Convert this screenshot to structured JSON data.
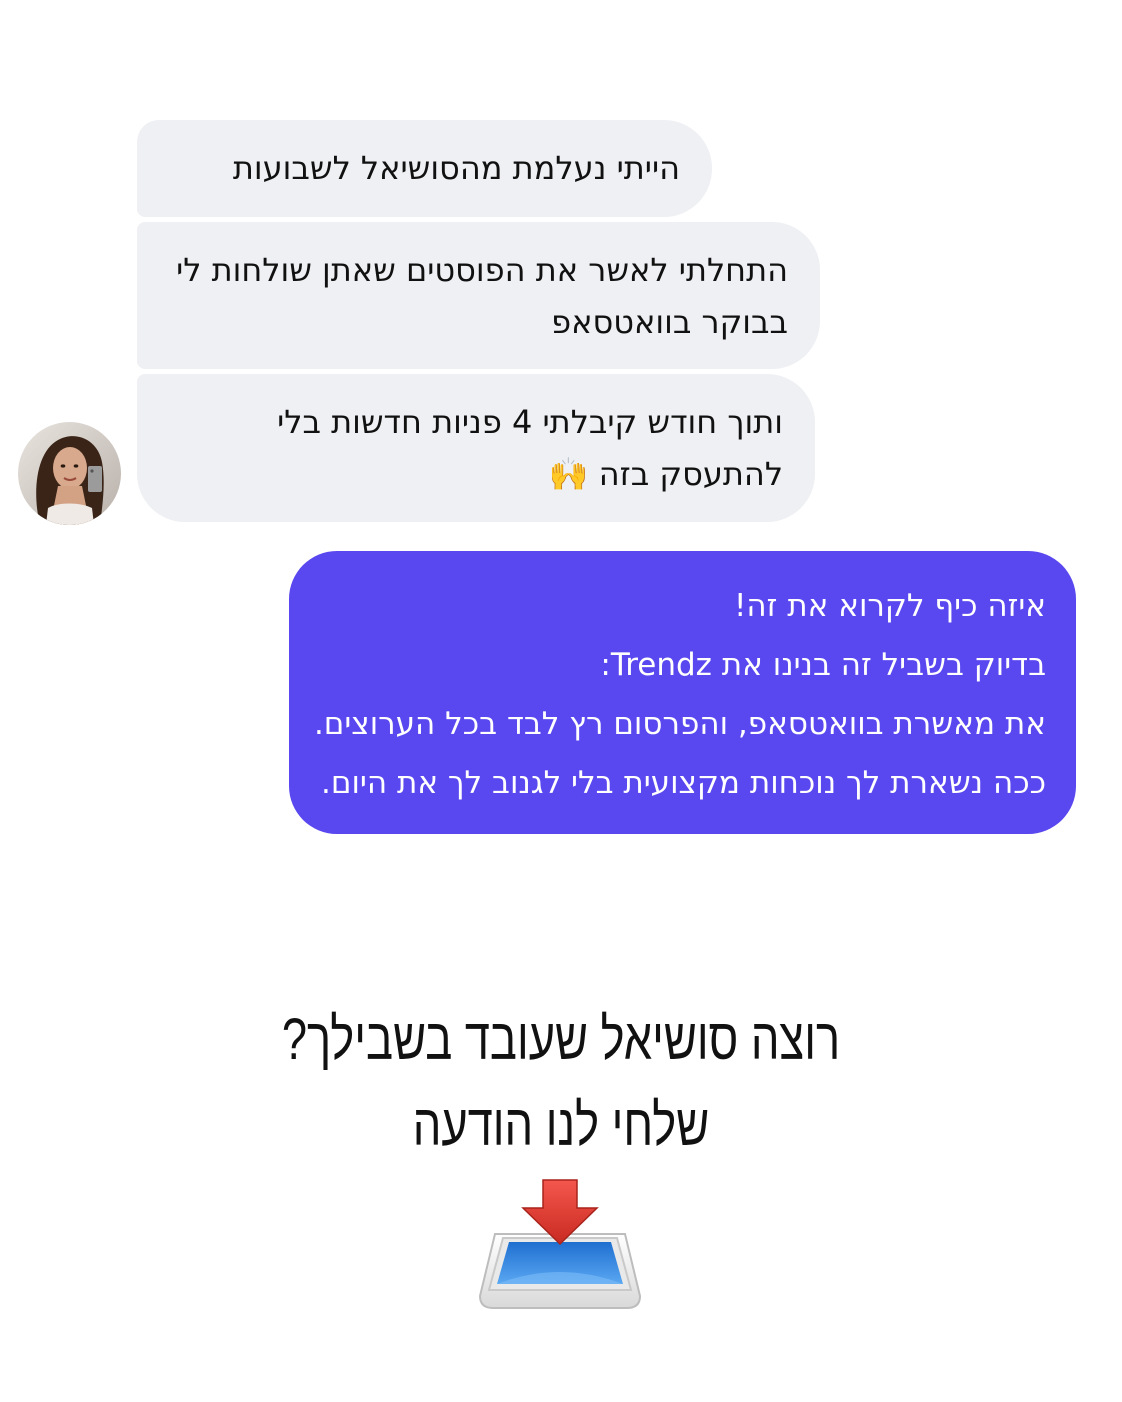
{
  "messages_incoming": [
    {
      "lines": [
        "הייתי נעלמת מהסושיאל לשבועות"
      ]
    },
    {
      "lines": [
        "התחלתי לאשר את הפוסטים שאתן שולחות לי",
        "בבוקר בוואטסאפ"
      ]
    },
    {
      "lines": [
        "ותוך חודש קיבלתי 4 פניות חדשות בלי",
        "להתעסק בזה 🙌"
      ]
    }
  ],
  "message_outgoing": {
    "lines": [
      "איזה כיף לקרוא את זה!",
      "בדיוק בשביל זה בנינו את Trendz:",
      "את מאשרת בוואטסאפ, והפרסום רץ לבד בכל הערוצים.",
      "ככה נשארת לך נוכחות מקצועית בלי לגנוב לך את היום."
    ]
  },
  "cta": {
    "line1": "רוצה סושיאל שעובד בשבילך?",
    "line2": "שלחי לנו הודעה"
  },
  "icons": {
    "avatar": "user-avatar-photo",
    "inbox": "inbox-tray-icon"
  },
  "colors": {
    "incoming_bubble": "#eef0f3",
    "outgoing_bubble": "#5947ef",
    "arrow": "#e8352c",
    "tray_blue": "#3d8fe6"
  }
}
